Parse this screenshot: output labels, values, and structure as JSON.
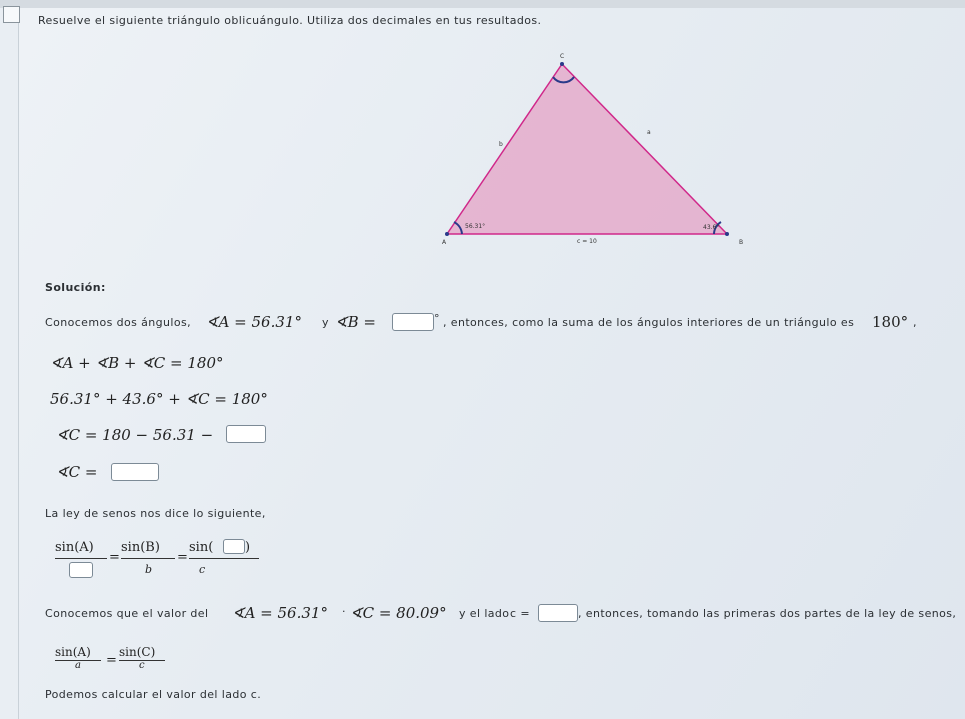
{
  "header": {
    "instruction": "Resuelve el siguiente triángulo oblicuángulo. Utiliza dos decimales en tus resultados."
  },
  "figure": {
    "vertex_a": "A",
    "vertex_b": "B",
    "vertex_c": "C",
    "side_a": "a",
    "side_b": "b",
    "side_c": "c",
    "angle_a": "56.31°",
    "angle_b": "43.6°",
    "side_c_value": "c = 10",
    "fill_color": "#e4a3c6",
    "stroke_color": "#d0288a"
  },
  "solution": {
    "heading": "Solución:",
    "line1_text_a": "Conocemos dos ángulos,",
    "line1_angle_a": "∢A = 56.31°",
    "line1_y": "y",
    "line1_angle_b": "∢B =",
    "line1_deg": "°",
    "line1_text_b": ", entonces, como la suma de los ángulos interiores de un triángulo es",
    "line1_sum": "180°",
    "line1_comma": ",",
    "eq1": "∢A + ∢B + ∢C = 180°",
    "eq2": "56.31° + 43.6° + ∢C = 180°",
    "eq3": "∢C = 180 − 56.31 −",
    "eq4": "∢C =",
    "law_text": "La ley de senos nos dice lo siguiente,",
    "law_num1": "sin(A)",
    "law_num2": "sin(B)",
    "law_num3a": "sin(",
    "law_num3b": ")",
    "law_eq": "=",
    "law_den2": "b",
    "law_den3": "c",
    "line2_text_a": "Conocemos que el valor del",
    "line2_angle_a": "∢A = 56.31°",
    "line2_dot": "·",
    "line2_angle_c": "∢C = 80.09°",
    "line2_text_b": "y el lado",
    "line2_side": "c =",
    "line2_text_c": ", entonces, tomando las primeras dos partes de la ley de senos,",
    "ratio_num1": "sin(A)",
    "ratio_den1": "a",
    "ratio_num2": "sin(C)",
    "ratio_den2": "c",
    "final_text": "Podemos calcular el valor del lado c."
  }
}
